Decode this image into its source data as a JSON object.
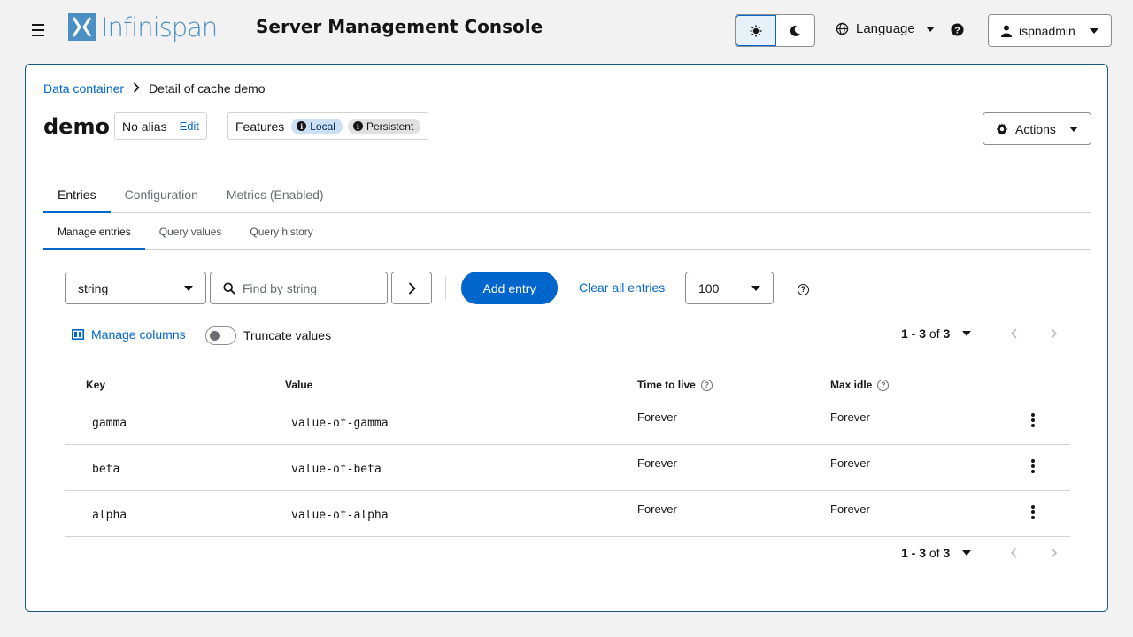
{
  "header": {
    "brand": "Infinispan",
    "title": "Server Management Console",
    "language_label": "Language",
    "user_label": "ispnadmin"
  },
  "breadcrumb": {
    "root": "Data container",
    "current": "Detail of cache demo"
  },
  "cache": {
    "name": "demo",
    "alias_text": "No alias",
    "edit_label": "Edit",
    "features_label": "Features",
    "features": [
      "Local",
      "Persistent"
    ],
    "actions_label": "Actions"
  },
  "tabs": [
    "Entries",
    "Configuration",
    "Metrics (Enabled)"
  ],
  "subtabs": [
    "Manage entries",
    "Query values",
    "Query history"
  ],
  "toolbar": {
    "key_type": "string",
    "search_placeholder": "Find by string",
    "add_label": "Add entry",
    "clear_label": "Clear all entries",
    "per_page": "100"
  },
  "table_controls": {
    "manage_columns": "Manage columns",
    "truncate_label": "Truncate values",
    "truncate_on": false
  },
  "pagination": {
    "range": "1 - 3",
    "of_text": "of",
    "total": "3"
  },
  "table": {
    "columns": [
      "Key",
      "Value",
      "Time to live",
      "Max idle"
    ],
    "rows": [
      {
        "key": "gamma",
        "value": "value-of-gamma",
        "ttl": "Forever",
        "idle": "Forever"
      },
      {
        "key": "beta",
        "value": "value-of-beta",
        "ttl": "Forever",
        "idle": "Forever"
      },
      {
        "key": "alpha",
        "value": "value-of-alpha",
        "ttl": "Forever",
        "idle": "Forever"
      }
    ]
  },
  "colors": {
    "primary": "#0066cc",
    "brand": "#4a90c4",
    "border": "#d2d2d2"
  }
}
